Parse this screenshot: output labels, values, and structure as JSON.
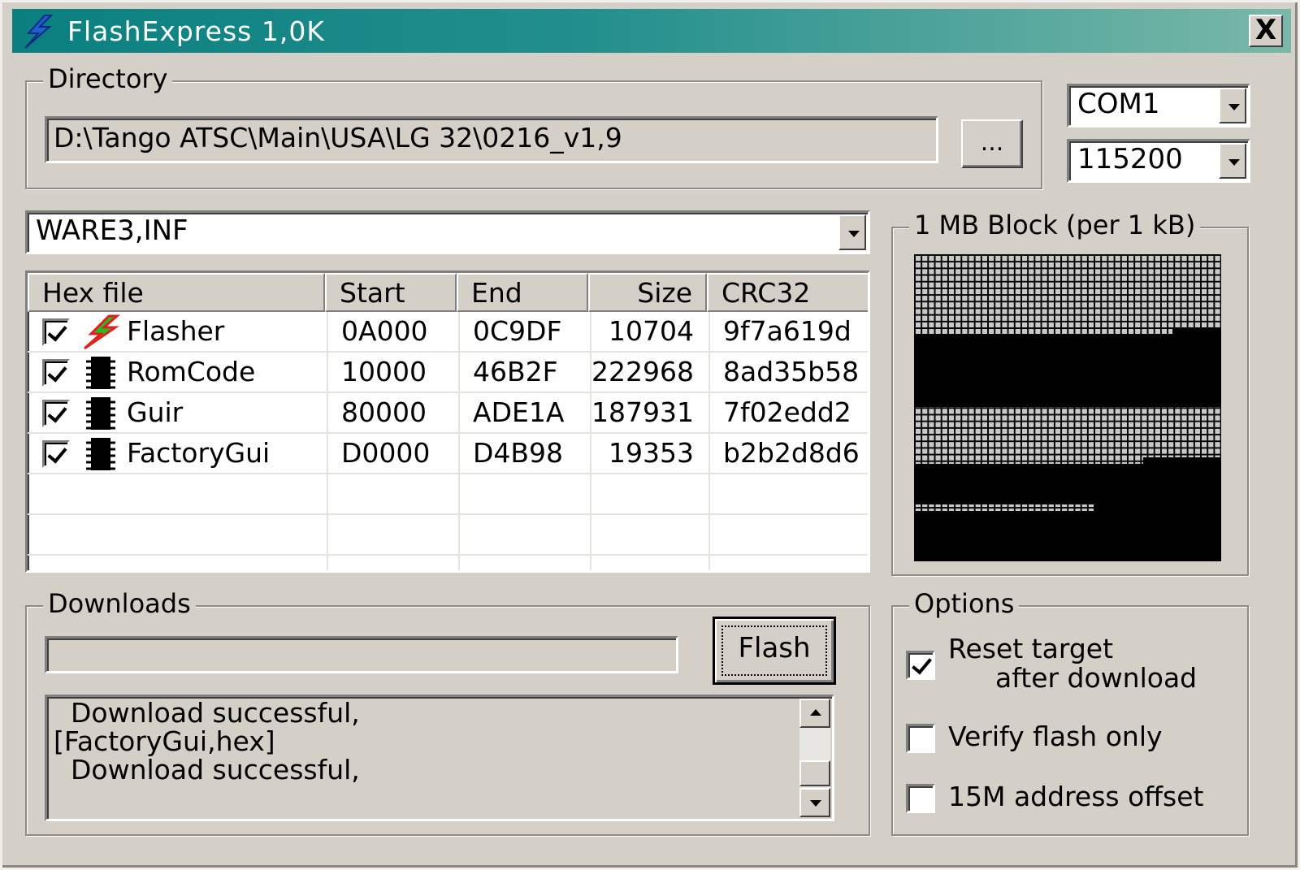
{
  "window": {
    "title": "FlashExpress 1,0K",
    "close_label": "X"
  },
  "directory": {
    "label": "Directory",
    "path": "D:\\Tango ATSC\\Main\\USA\\LG 32\\0216_v1,9",
    "browse_label": "..."
  },
  "port": {
    "com": "COM1",
    "baud": "115200"
  },
  "config_file": "WARE3,INF",
  "table": {
    "columns": [
      "Hex file",
      "Start",
      "End",
      "Size",
      "CRC32"
    ],
    "rows": [
      {
        "name": "Flasher",
        "icon": "lightning-icon",
        "checked": true,
        "start": "0A000",
        "end": "0C9DF",
        "size": "10704",
        "crc": "9f7a619d"
      },
      {
        "name": "RomCode",
        "icon": "chip-icon",
        "checked": true,
        "start": "10000",
        "end": "46B2F",
        "size": "222968",
        "crc": "8ad35b58"
      },
      {
        "name": "Guir",
        "icon": "chip-icon",
        "checked": true,
        "start": "80000",
        "end": "ADE1A",
        "size": "187931",
        "crc": "7f02edd2"
      },
      {
        "name": "FactoryGui",
        "icon": "chip-icon",
        "checked": true,
        "start": "D0000",
        "end": "D4B98",
        "size": "19353",
        "crc": "b2b2d8d6"
      }
    ]
  },
  "block_map": {
    "label": "1 MB Block (per 1 kB)"
  },
  "downloads": {
    "label": "Downloads",
    "flash_label": "Flash",
    "progress": 0,
    "log": [
      "  Download successful,",
      "[FactoryGui,hex]",
      "  Download successful,"
    ]
  },
  "options": {
    "label": "Options",
    "reset_line1": "Reset target",
    "reset_line2": "after download",
    "reset_checked": true,
    "verify_label": "Verify flash only",
    "verify_checked": false,
    "offset_label": "15M address offset",
    "offset_checked": false
  },
  "colors": {
    "title_start": "#0b7f80",
    "title_end": "#79b8a8",
    "face": "#d4d0c8"
  }
}
